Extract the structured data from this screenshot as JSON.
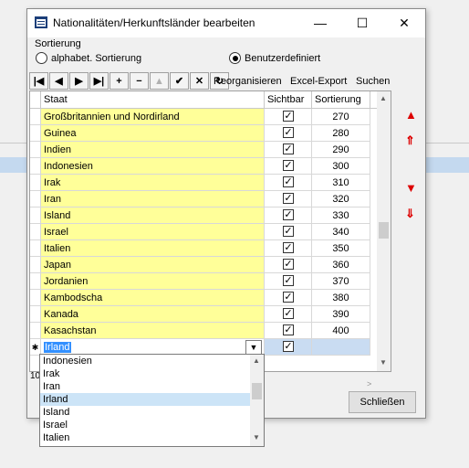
{
  "window": {
    "title": "Nationalitäten/Herkunftsländer bearbeiten",
    "minimize_glyph": "—",
    "maximize_glyph": "☐",
    "close_glyph": "✕"
  },
  "sorting": {
    "label": "Sortierung",
    "option_alpha": "alphabet. Sortierung",
    "option_custom": "Benutzerdefiniert",
    "selected": "Benutzerdefiniert"
  },
  "toolbar": {
    "buttons": [
      "|◀",
      "◀",
      "▶",
      "▶|",
      "+",
      "−",
      "▲",
      "✔",
      "✕",
      "↻"
    ],
    "reorganize_label": "Reorganisieren",
    "excel_label": "Excel-Export",
    "search_label": "Suchen"
  },
  "grid": {
    "headers": {
      "staat": "Staat",
      "sichtbar": "Sichtbar",
      "sortierung": "Sortierung"
    },
    "rows": [
      {
        "staat": "Großbritannien und Nordirland",
        "sichtbar": "✓",
        "sortierung": "270"
      },
      {
        "staat": "Guinea",
        "sichtbar": "✓",
        "sortierung": "280"
      },
      {
        "staat": "Indien",
        "sichtbar": "✓",
        "sortierung": "290"
      },
      {
        "staat": "Indonesien",
        "sichtbar": "✓",
        "sortierung": "300"
      },
      {
        "staat": "Irak",
        "sichtbar": "✓",
        "sortierung": "310"
      },
      {
        "staat": "Iran",
        "sichtbar": "✓",
        "sortierung": "320"
      },
      {
        "staat": "Island",
        "sichtbar": "✓",
        "sortierung": "330"
      },
      {
        "staat": "Israel",
        "sichtbar": "✓",
        "sortierung": "340"
      },
      {
        "staat": "Italien",
        "sichtbar": "✓",
        "sortierung": "350"
      },
      {
        "staat": "Japan",
        "sichtbar": "✓",
        "sortierung": "360"
      },
      {
        "staat": "Jordanien",
        "sichtbar": "✓",
        "sortierung": "370"
      },
      {
        "staat": "Kambodscha",
        "sichtbar": "✓",
        "sortierung": "380"
      },
      {
        "staat": "Kanada",
        "sichtbar": "✓",
        "sortierung": "390"
      },
      {
        "staat": "Kasachstan",
        "sichtbar": "✓",
        "sortierung": "400"
      }
    ],
    "new_row": {
      "marker": "✱",
      "staat": "Irland",
      "sichtbar": "✓",
      "sortierung": ""
    },
    "partial_text": "10"
  },
  "dropdown": {
    "items": [
      "Indonesien",
      "Irak",
      "Iran",
      "Irland",
      "Island",
      "Israel",
      "Italien"
    ],
    "selected": "Irland"
  },
  "side_buttons": [
    "▲",
    "⇑",
    "▼",
    "⇓"
  ],
  "close_button": "Schließen",
  "colors": {
    "highlight": "#ffff99",
    "accent_red": "#dd0000",
    "selection_blue": "#3390ff"
  }
}
